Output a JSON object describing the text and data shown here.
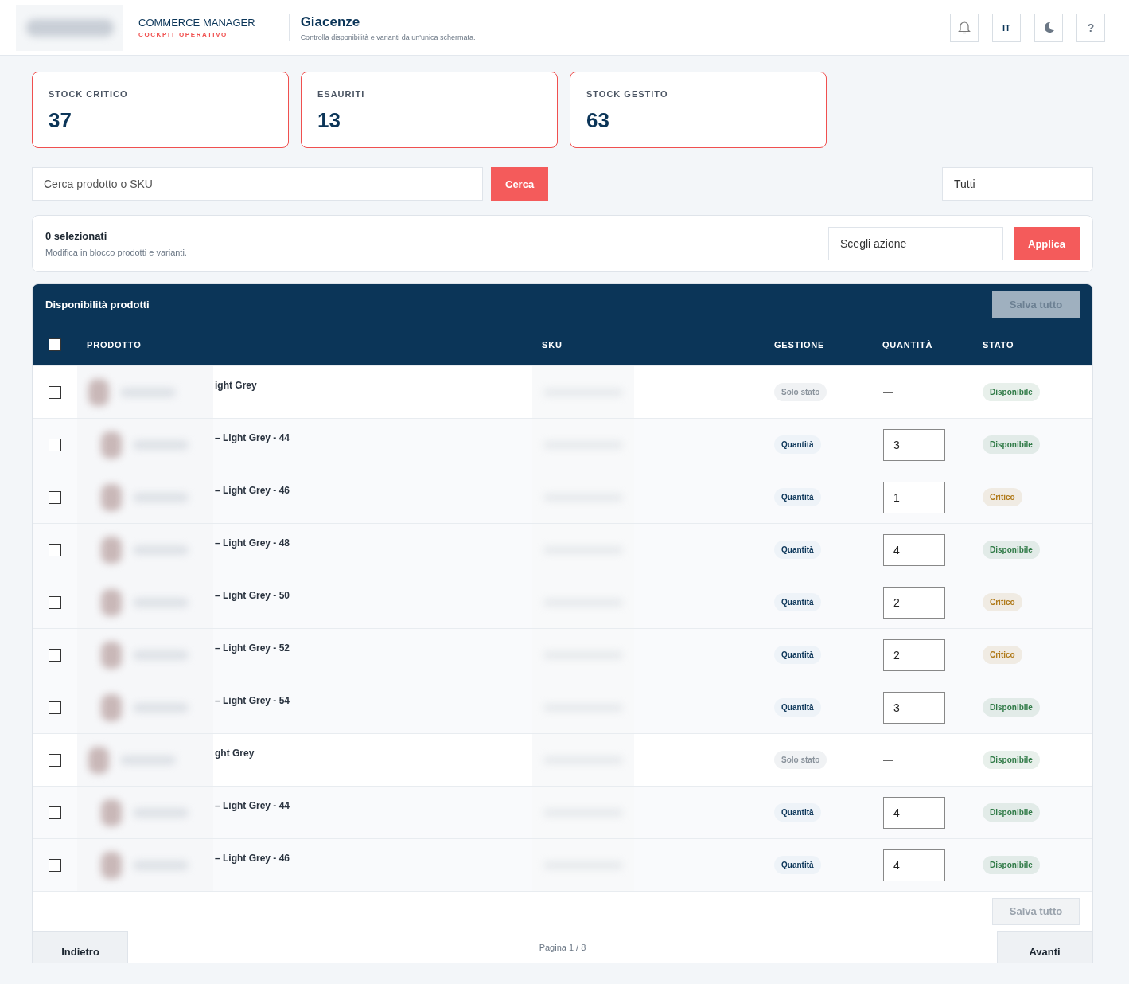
{
  "header": {
    "brand_title": "COMMERCE MANAGER",
    "brand_subtitle": "COCKPIT OPERATIVO",
    "page_title": "Giacenze",
    "page_subtitle": "Controlla disponibilità e varianti da un'unica schermata.",
    "language": "IT",
    "help": "?"
  },
  "stats": [
    {
      "label": "STOCK CRITICO",
      "value": "37"
    },
    {
      "label": "ESAURITI",
      "value": "13"
    },
    {
      "label": "STOCK GESTITO",
      "value": "63"
    }
  ],
  "search": {
    "placeholder": "Cerca prodotto o SKU",
    "button": "Cerca",
    "filter": "Tutti"
  },
  "bulk": {
    "count": "0 selezionati",
    "hint": "Modifica in blocco prodotti e varianti.",
    "action_placeholder": "Scegli azione",
    "apply": "Applica"
  },
  "table": {
    "title": "Disponibilità prodotti",
    "save_top": {
      "label": "Salva tutto",
      "disabled": true
    },
    "select_all": {
      "checked": false
    },
    "columns": [
      "PRODOTTO",
      "SKU",
      "GESTIONE",
      "QUANTITÀ",
      "STATO"
    ],
    "rows": [
      {
        "kind": "parent",
        "checked": false,
        "name": "ight Grey",
        "mode": "Solo stato",
        "quantity": "—",
        "status": "Disponibile",
        "color": "#2f7a46"
      },
      {
        "kind": "variant",
        "checked": false,
        "name": "– Light Grey - 44",
        "mode": "Quantità",
        "quantity": "3",
        "status": "Disponibile",
        "color": "#2f7a46"
      },
      {
        "kind": "variant",
        "checked": false,
        "name": "– Light Grey - 46",
        "mode": "Quantità",
        "quantity": "1",
        "status": "Critico",
        "color": "#b07a1a"
      },
      {
        "kind": "variant",
        "checked": false,
        "name": "– Light Grey - 48",
        "mode": "Quantità",
        "quantity": "4",
        "status": "Disponibile",
        "color": "#2f7a46"
      },
      {
        "kind": "variant",
        "checked": false,
        "name": "– Light Grey - 50",
        "mode": "Quantità",
        "quantity": "2",
        "status": "Critico",
        "color": "#b07a1a"
      },
      {
        "kind": "variant",
        "checked": false,
        "name": "– Light Grey - 52",
        "mode": "Quantità",
        "quantity": "2",
        "status": "Critico",
        "color": "#b07a1a"
      },
      {
        "kind": "variant",
        "checked": false,
        "name": "– Light Grey - 54",
        "mode": "Quantità",
        "quantity": "3",
        "status": "Disponibile",
        "color": "#2f7a46"
      },
      {
        "kind": "parent",
        "checked": false,
        "name": "ght Grey",
        "mode": "Solo stato",
        "quantity": "—",
        "status": "Disponibile",
        "color": "#2f7a46"
      },
      {
        "kind": "variant",
        "checked": false,
        "name": "– Light Grey - 44",
        "mode": "Quantità",
        "quantity": "4",
        "status": "Disponibile",
        "color": "#2f7a46"
      },
      {
        "kind": "variant",
        "checked": false,
        "name": "– Light Grey - 46",
        "mode": "Quantità",
        "quantity": "4",
        "status": "Disponibile",
        "color": "#2f7a46"
      }
    ],
    "save_bottom": {
      "label": "Salva tutto",
      "disabled": true
    }
  },
  "pagination": {
    "back": "Indietro",
    "page": "Pagina 1 / 8",
    "next": "Avanti"
  }
}
